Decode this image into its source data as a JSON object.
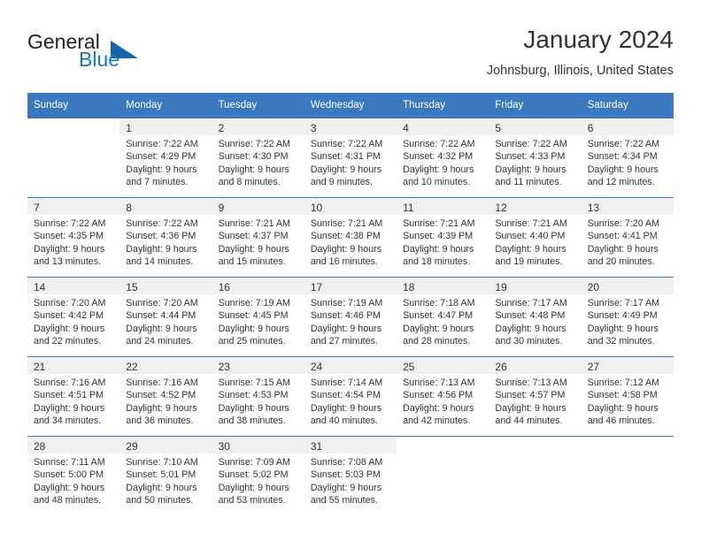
{
  "brand": {
    "name_part1": "General",
    "name_part2": "Blue",
    "logo_icon": "triangle-logo-icon"
  },
  "header": {
    "title": "January 2024",
    "location": "Johnsburg, Illinois, United States"
  },
  "colors": {
    "header_blue": "#3a79bd",
    "brand_blue": "#1279c4",
    "logo_blue": "#1565ad",
    "daynum_band": "#f0f0f0",
    "text": "#333333"
  },
  "weekday_headers": [
    "Sunday",
    "Monday",
    "Tuesday",
    "Wednesday",
    "Thursday",
    "Friday",
    "Saturday"
  ],
  "weeks": [
    [
      {
        "day": "",
        "blank": true,
        "lines": []
      },
      {
        "day": "1",
        "lines": [
          "Sunrise: 7:22 AM",
          "Sunset: 4:29 PM",
          "Daylight: 9 hours",
          "and 7 minutes."
        ]
      },
      {
        "day": "2",
        "lines": [
          "Sunrise: 7:22 AM",
          "Sunset: 4:30 PM",
          "Daylight: 9 hours",
          "and 8 minutes."
        ]
      },
      {
        "day": "3",
        "lines": [
          "Sunrise: 7:22 AM",
          "Sunset: 4:31 PM",
          "Daylight: 9 hours",
          "and 9 minutes."
        ]
      },
      {
        "day": "4",
        "lines": [
          "Sunrise: 7:22 AM",
          "Sunset: 4:32 PM",
          "Daylight: 9 hours",
          "and 10 minutes."
        ]
      },
      {
        "day": "5",
        "lines": [
          "Sunrise: 7:22 AM",
          "Sunset: 4:33 PM",
          "Daylight: 9 hours",
          "and 11 minutes."
        ]
      },
      {
        "day": "6",
        "lines": [
          "Sunrise: 7:22 AM",
          "Sunset: 4:34 PM",
          "Daylight: 9 hours",
          "and 12 minutes."
        ]
      }
    ],
    [
      {
        "day": "7",
        "lines": [
          "Sunrise: 7:22 AM",
          "Sunset: 4:35 PM",
          "Daylight: 9 hours",
          "and 13 minutes."
        ]
      },
      {
        "day": "8",
        "lines": [
          "Sunrise: 7:22 AM",
          "Sunset: 4:36 PM",
          "Daylight: 9 hours",
          "and 14 minutes."
        ]
      },
      {
        "day": "9",
        "lines": [
          "Sunrise: 7:21 AM",
          "Sunset: 4:37 PM",
          "Daylight: 9 hours",
          "and 15 minutes."
        ]
      },
      {
        "day": "10",
        "lines": [
          "Sunrise: 7:21 AM",
          "Sunset: 4:38 PM",
          "Daylight: 9 hours",
          "and 16 minutes."
        ]
      },
      {
        "day": "11",
        "lines": [
          "Sunrise: 7:21 AM",
          "Sunset: 4:39 PM",
          "Daylight: 9 hours",
          "and 18 minutes."
        ]
      },
      {
        "day": "12",
        "lines": [
          "Sunrise: 7:21 AM",
          "Sunset: 4:40 PM",
          "Daylight: 9 hours",
          "and 19 minutes."
        ]
      },
      {
        "day": "13",
        "lines": [
          "Sunrise: 7:20 AM",
          "Sunset: 4:41 PM",
          "Daylight: 9 hours",
          "and 20 minutes."
        ]
      }
    ],
    [
      {
        "day": "14",
        "lines": [
          "Sunrise: 7:20 AM",
          "Sunset: 4:42 PM",
          "Daylight: 9 hours",
          "and 22 minutes."
        ]
      },
      {
        "day": "15",
        "lines": [
          "Sunrise: 7:20 AM",
          "Sunset: 4:44 PM",
          "Daylight: 9 hours",
          "and 24 minutes."
        ]
      },
      {
        "day": "16",
        "lines": [
          "Sunrise: 7:19 AM",
          "Sunset: 4:45 PM",
          "Daylight: 9 hours",
          "and 25 minutes."
        ]
      },
      {
        "day": "17",
        "lines": [
          "Sunrise: 7:19 AM",
          "Sunset: 4:46 PM",
          "Daylight: 9 hours",
          "and 27 minutes."
        ]
      },
      {
        "day": "18",
        "lines": [
          "Sunrise: 7:18 AM",
          "Sunset: 4:47 PM",
          "Daylight: 9 hours",
          "and 28 minutes."
        ]
      },
      {
        "day": "19",
        "lines": [
          "Sunrise: 7:17 AM",
          "Sunset: 4:48 PM",
          "Daylight: 9 hours",
          "and 30 minutes."
        ]
      },
      {
        "day": "20",
        "lines": [
          "Sunrise: 7:17 AM",
          "Sunset: 4:49 PM",
          "Daylight: 9 hours",
          "and 32 minutes."
        ]
      }
    ],
    [
      {
        "day": "21",
        "lines": [
          "Sunrise: 7:16 AM",
          "Sunset: 4:51 PM",
          "Daylight: 9 hours",
          "and 34 minutes."
        ]
      },
      {
        "day": "22",
        "lines": [
          "Sunrise: 7:16 AM",
          "Sunset: 4:52 PM",
          "Daylight: 9 hours",
          "and 36 minutes."
        ]
      },
      {
        "day": "23",
        "lines": [
          "Sunrise: 7:15 AM",
          "Sunset: 4:53 PM",
          "Daylight: 9 hours",
          "and 38 minutes."
        ]
      },
      {
        "day": "24",
        "lines": [
          "Sunrise: 7:14 AM",
          "Sunset: 4:54 PM",
          "Daylight: 9 hours",
          "and 40 minutes."
        ]
      },
      {
        "day": "25",
        "lines": [
          "Sunrise: 7:13 AM",
          "Sunset: 4:56 PM",
          "Daylight: 9 hours",
          "and 42 minutes."
        ]
      },
      {
        "day": "26",
        "lines": [
          "Sunrise: 7:13 AM",
          "Sunset: 4:57 PM",
          "Daylight: 9 hours",
          "and 44 minutes."
        ]
      },
      {
        "day": "27",
        "lines": [
          "Sunrise: 7:12 AM",
          "Sunset: 4:58 PM",
          "Daylight: 9 hours",
          "and 46 minutes."
        ]
      }
    ],
    [
      {
        "day": "28",
        "lines": [
          "Sunrise: 7:11 AM",
          "Sunset: 5:00 PM",
          "Daylight: 9 hours",
          "and 48 minutes."
        ]
      },
      {
        "day": "29",
        "lines": [
          "Sunrise: 7:10 AM",
          "Sunset: 5:01 PM",
          "Daylight: 9 hours",
          "and 50 minutes."
        ]
      },
      {
        "day": "30",
        "lines": [
          "Sunrise: 7:09 AM",
          "Sunset: 5:02 PM",
          "Daylight: 9 hours",
          "and 53 minutes."
        ]
      },
      {
        "day": "31",
        "lines": [
          "Sunrise: 7:08 AM",
          "Sunset: 5:03 PM",
          "Daylight: 9 hours",
          "and 55 minutes."
        ]
      },
      {
        "day": "",
        "blank": true,
        "lines": []
      },
      {
        "day": "",
        "blank": true,
        "lines": []
      },
      {
        "day": "",
        "blank": true,
        "lines": []
      }
    ]
  ]
}
